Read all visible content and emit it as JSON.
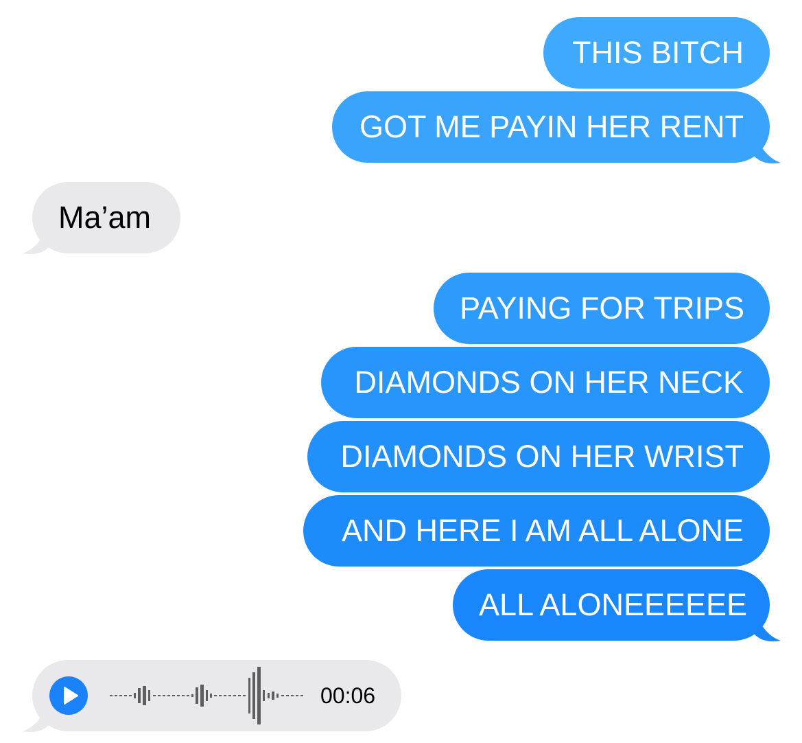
{
  "conversation": {
    "messages": [
      {
        "direction": "sent",
        "text": "THIS BITCH"
      },
      {
        "direction": "sent",
        "text": "GOT ME PAYIN HER RENT"
      },
      {
        "direction": "received",
        "text": "Ma’am"
      },
      {
        "direction": "sent",
        "text": "PAYING FOR TRIPS"
      },
      {
        "direction": "sent",
        "text": "DIAMONDS ON HER NECK"
      },
      {
        "direction": "sent",
        "text": "DIAMONDS ON HER WRIST"
      },
      {
        "direction": "sent",
        "text": "AND HERE I AM ALL ALONE"
      },
      {
        "direction": "sent",
        "text": "ALL ALONEEEEEE"
      }
    ],
    "audio_message": {
      "duration": "00:06",
      "play_icon": "play-icon"
    }
  },
  "colors": {
    "sent_bubble_top": "#3ea8fd",
    "sent_bubble_bottom": "#1a82fb",
    "received_bubble": "#e9e9eb",
    "waveform": "#5e5e62"
  }
}
